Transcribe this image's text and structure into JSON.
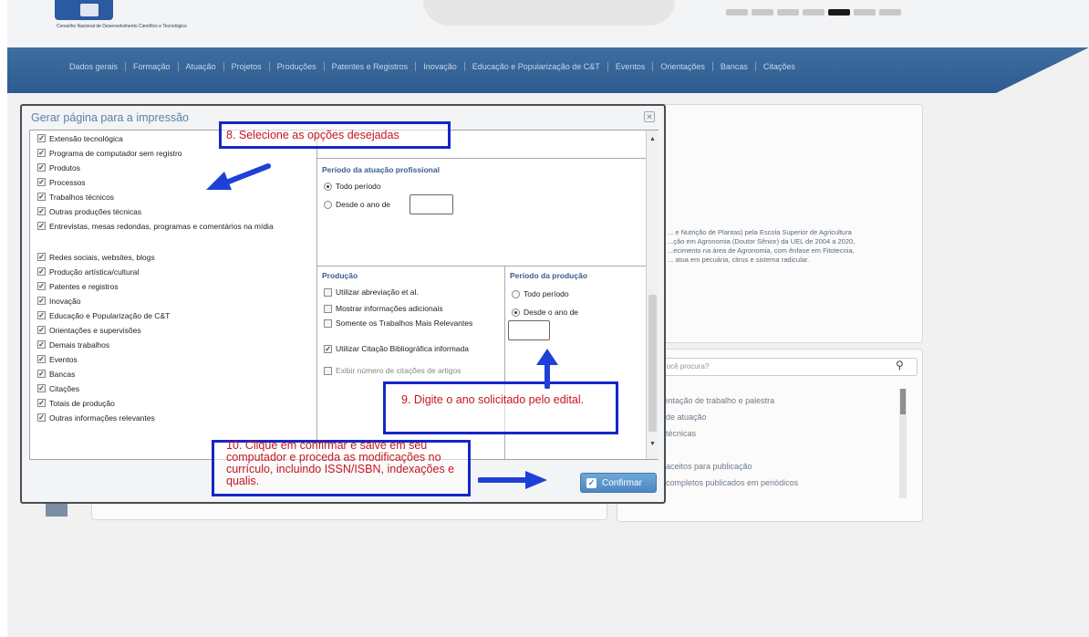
{
  "header": {
    "logo_text": "Conselho Nacional de Desenvolvimento Científico e Tecnológico"
  },
  "nav": {
    "items": [
      "Dados gerais",
      "Formação",
      "Atuação",
      "Projetos",
      "Produções",
      "Patentes e Registros",
      "Inovação",
      "Educação e Popularização de C&T",
      "Eventos",
      "Orientações",
      "Bancas",
      "Citações"
    ]
  },
  "background": {
    "summary_lines": [
      "... e Nutrição de Plantas) pela Escola Superior de Agricultura",
      "...ção em Agronomia (Doutor Sênior) da UEL de 2004 a 2020,",
      "...ecimento na área de Agronomia, com ênfase em Fitotecnia,",
      "... atua em pecuária, citrus e sistema radicular."
    ],
    "search_placeholder": "...ocê procura?",
    "search_list": [
      "...entação de trabalho e palestra",
      "... de atuação",
      "... técnicas",
      "... aceitos para publicação",
      "... completos publicados em periódicos"
    ]
  },
  "modal": {
    "title": "Gerar página para a impressão",
    "close_label": "✕",
    "left_items": [
      {
        "label": "Extensão tecnológica",
        "checked": true
      },
      {
        "label": "Programa de computador sem registro",
        "checked": true
      },
      {
        "label": "Produtos",
        "checked": true
      },
      {
        "label": "Processos",
        "checked": true
      },
      {
        "label": "Trabalhos técnicos",
        "checked": true
      },
      {
        "label": "Outras produções técnicas",
        "checked": true
      },
      {
        "label": "Entrevistas, mesas redondas, programas e comentários na mídia",
        "checked": true
      },
      {
        "label": "Redes sociais, websites, blogs",
        "checked": true
      },
      {
        "label": "Produção artística/cultural",
        "checked": true
      },
      {
        "label": "Patentes e registros",
        "checked": true
      },
      {
        "label": "Inovação",
        "checked": true
      },
      {
        "label": "Educação e Popularização de C&T",
        "checked": true
      },
      {
        "label": "Orientações e supervisões",
        "checked": true
      },
      {
        "label": "Demais trabalhos",
        "checked": true
      },
      {
        "label": "Eventos",
        "checked": true
      },
      {
        "label": "Bancas",
        "checked": true
      },
      {
        "label": "Citações",
        "checked": true
      },
      {
        "label": "Totais de produção",
        "checked": true
      },
      {
        "label": "Outras informações relevantes",
        "checked": true
      }
    ],
    "atuacao": {
      "title": "Período da atuação profissional",
      "option_all": "Todo período",
      "option_since": "Desde o ano de",
      "selected": "all",
      "year_value": ""
    },
    "producao": {
      "title": "Produção",
      "options": [
        {
          "label": "Utilizar abreviação et al.",
          "checked": false
        },
        {
          "label": "Mostrar informações adicionais",
          "checked": false
        },
        {
          "label": "Somente os Trabalhos Mais Relevantes",
          "checked": false
        },
        {
          "label": "Utilizar Citação Bibliográfica informada",
          "checked": true
        },
        {
          "label": "Exibir número de citações de artigos",
          "checked": false
        }
      ]
    },
    "periodo_producao": {
      "title": "Período da produção",
      "option_all": "Todo período",
      "option_since": "Desde o ano de",
      "selected": "since",
      "year_value": ""
    },
    "confirm_label": "Confirmar"
  },
  "annotations": {
    "step8": "8. Selecione as opções desejadas",
    "step9": "9. Digite o ano solicitado pelo edital.",
    "step10": "10. Clique em confirmar e salve em seu computador e proceda as modificações no currículo, incluindo ISSN/ISBN, indexações e qualis."
  },
  "colors": {
    "nav": "#2e5b8f",
    "annotation_box": "#1526c8",
    "annotation_text": "#c4161c",
    "confirm": "#4d88c2"
  }
}
